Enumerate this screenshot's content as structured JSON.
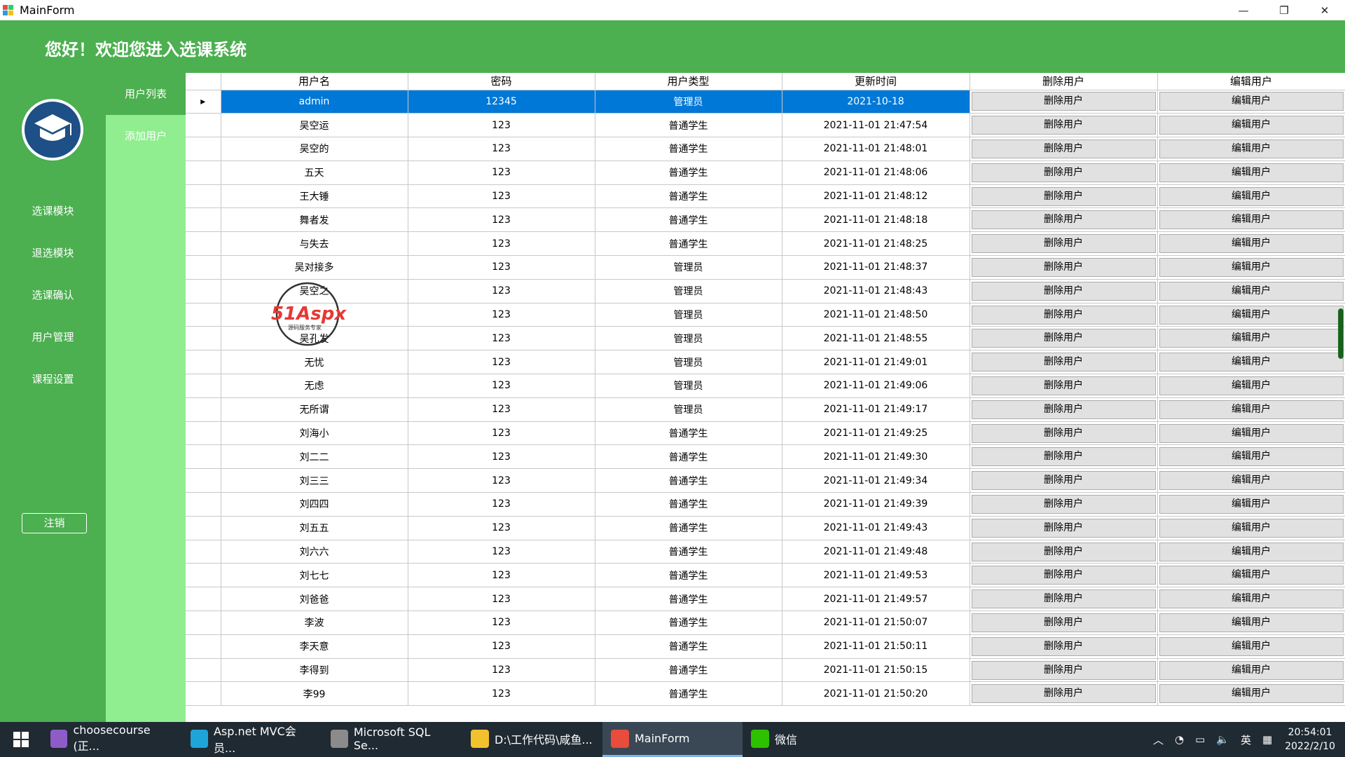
{
  "window": {
    "title": "MainForm",
    "minimize": "—",
    "maximize": "❐",
    "close": "✕"
  },
  "header": {
    "welcome": "您好！欢迎您进入选课系统"
  },
  "sidebar": {
    "items": [
      {
        "label": "选课模块"
      },
      {
        "label": "退选模块"
      },
      {
        "label": "选课确认"
      },
      {
        "label": "用户管理"
      },
      {
        "label": "课程设置"
      }
    ],
    "logout": "注销"
  },
  "subnav": {
    "items": [
      {
        "label": "用户列表"
      },
      {
        "label": "添加用户"
      }
    ]
  },
  "grid": {
    "columns": [
      "用户名",
      "密码",
      "用户类型",
      "更新时间",
      "删除用户",
      "编辑用户"
    ],
    "delete_label": "删除用户",
    "edit_label": "编辑用户",
    "rows": [
      {
        "username": "admin",
        "password": "12345",
        "type": "管理员",
        "updated": "2021-10-18"
      },
      {
        "username": "吴空运",
        "password": "123",
        "type": "普通学生",
        "updated": "2021-11-01 21:47:54"
      },
      {
        "username": "吴空的",
        "password": "123",
        "type": "普通学生",
        "updated": "2021-11-01 21:48:01"
      },
      {
        "username": "五天",
        "password": "123",
        "type": "普通学生",
        "updated": "2021-11-01 21:48:06"
      },
      {
        "username": "王大锤",
        "password": "123",
        "type": "普通学生",
        "updated": "2021-11-01 21:48:12"
      },
      {
        "username": "舞者发",
        "password": "123",
        "type": "普通学生",
        "updated": "2021-11-01 21:48:18"
      },
      {
        "username": "与失去",
        "password": "123",
        "type": "普通学生",
        "updated": "2021-11-01 21:48:25"
      },
      {
        "username": "吴对接多",
        "password": "123",
        "type": "管理员",
        "updated": "2021-11-01 21:48:37"
      },
      {
        "username": "吴空之",
        "password": "123",
        "type": "管理员",
        "updated": "2021-11-01 21:48:43"
      },
      {
        "username": "",
        "password": "123",
        "type": "管理员",
        "updated": "2021-11-01 21:48:50"
      },
      {
        "username": "吴孔发",
        "password": "123",
        "type": "管理员",
        "updated": "2021-11-01 21:48:55"
      },
      {
        "username": "无忧",
        "password": "123",
        "type": "管理员",
        "updated": "2021-11-01 21:49:01"
      },
      {
        "username": "无虑",
        "password": "123",
        "type": "管理员",
        "updated": "2021-11-01 21:49:06"
      },
      {
        "username": "无所谓",
        "password": "123",
        "type": "管理员",
        "updated": "2021-11-01 21:49:17"
      },
      {
        "username": "刘海小",
        "password": "123",
        "type": "普通学生",
        "updated": "2021-11-01 21:49:25"
      },
      {
        "username": "刘二二",
        "password": "123",
        "type": "普通学生",
        "updated": "2021-11-01 21:49:30"
      },
      {
        "username": "刘三三",
        "password": "123",
        "type": "普通学生",
        "updated": "2021-11-01 21:49:34"
      },
      {
        "username": "刘四四",
        "password": "123",
        "type": "普通学生",
        "updated": "2021-11-01 21:49:39"
      },
      {
        "username": "刘五五",
        "password": "123",
        "type": "普通学生",
        "updated": "2021-11-01 21:49:43"
      },
      {
        "username": "刘六六",
        "password": "123",
        "type": "普通学生",
        "updated": "2021-11-01 21:49:48"
      },
      {
        "username": "刘七七",
        "password": "123",
        "type": "普通学生",
        "updated": "2021-11-01 21:49:53"
      },
      {
        "username": "刘爸爸",
        "password": "123",
        "type": "普通学生",
        "updated": "2021-11-01 21:49:57"
      },
      {
        "username": "李波",
        "password": "123",
        "type": "普通学生",
        "updated": "2021-11-01 21:50:07"
      },
      {
        "username": "李天意",
        "password": "123",
        "type": "普通学生",
        "updated": "2021-11-01 21:50:11"
      },
      {
        "username": "李得到",
        "password": "123",
        "type": "普通学生",
        "updated": "2021-11-01 21:50:15"
      },
      {
        "username": "李99",
        "password": "123",
        "type": "普通学生",
        "updated": "2021-11-01 21:50:20"
      }
    ]
  },
  "watermark": {
    "text": "51Aspx",
    "subtext": "源码服务专家"
  },
  "taskbar": {
    "items": [
      {
        "label": "choosecourse (正...",
        "icon": "visual-studio-icon",
        "color": "#8e5cc7"
      },
      {
        "label": "Asp.net MVC会员...",
        "icon": "edge-icon",
        "color": "#1fa4d8"
      },
      {
        "label": "Microsoft SQL Se...",
        "icon": "sql-server-icon",
        "color": "#8b8b8b"
      },
      {
        "label": "D:\\工作代码\\咸鱼...",
        "icon": "folder-icon",
        "color": "#f2c12e"
      },
      {
        "label": "MainForm",
        "icon": "app-icon",
        "color": "#e74c3c"
      },
      {
        "label": "微信",
        "icon": "wechat-icon",
        "color": "#2dc100"
      }
    ],
    "tray": {
      "ime": "英",
      "time": "20:54:01",
      "date": "2022/2/10"
    }
  },
  "colors": {
    "header_green": "#4caf50",
    "subnav_green": "#90ee90",
    "selected_blue": "#0078d7"
  }
}
